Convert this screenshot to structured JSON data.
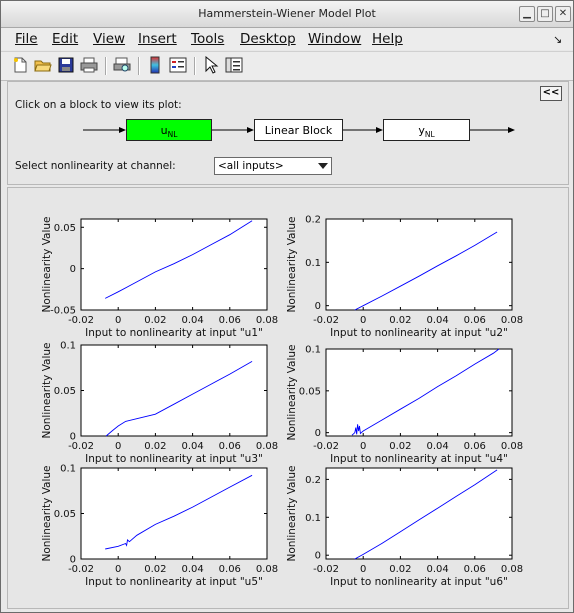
{
  "window": {
    "title": "Hammerstein-Wiener Model Plot"
  },
  "menu": [
    {
      "label": "File",
      "name": "menu-file"
    },
    {
      "label": "Edit",
      "name": "menu-edit"
    },
    {
      "label": "View",
      "name": "menu-view"
    },
    {
      "label": "Insert",
      "name": "menu-insert"
    },
    {
      "label": "Tools",
      "name": "menu-tools"
    },
    {
      "label": "Desktop",
      "name": "menu-desktop"
    },
    {
      "label": "Window",
      "name": "menu-window"
    },
    {
      "label": "Help",
      "name": "menu-help"
    }
  ],
  "toolbar": {
    "icons": [
      "new-figure-icon",
      "open-file-icon",
      "save-icon",
      "print-icon",
      "print-preview-icon",
      "colorbar-icon",
      "legend-icon",
      "pointer-icon",
      "property-editor-icon"
    ]
  },
  "panel": {
    "hint": "Click on a block to view its plot:",
    "collapse_label": "<<",
    "blocks": {
      "input_nl": {
        "main": "u",
        "sub": "NL",
        "color": "#00ff00"
      },
      "linear": {
        "label": "Linear Block"
      },
      "output_nl": {
        "main": "y",
        "sub": "NL",
        "color": "#ffffff"
      }
    },
    "select_label": "Select nonlinearity at channel:",
    "select_value": "<all inputs>"
  },
  "chart_data": [
    {
      "type": "line",
      "title": "",
      "xlabel": "Input to nonlinearity at input \"u1\"",
      "ylabel": "Nonlinearity Value",
      "xlim": [
        -0.02,
        0.08
      ],
      "ylim": [
        -0.05,
        0.06
      ],
      "xticks": [
        "-0.02",
        "0",
        "0.02",
        "0.04",
        "0.06",
        "0.08"
      ],
      "xtick_values": [
        -0.02,
        0,
        0.02,
        0.04,
        0.06,
        0.08
      ],
      "yticks": [
        "-0.05",
        "0",
        "0.05"
      ],
      "ytick_values": [
        -0.05,
        0,
        0.05
      ],
      "x": [
        -0.007,
        0.0,
        0.01,
        0.02,
        0.03,
        0.04,
        0.05,
        0.06,
        0.072
      ],
      "y": [
        -0.036,
        -0.028,
        -0.016,
        -0.004,
        0.006,
        0.017,
        0.029,
        0.041,
        0.058
      ],
      "color": "#0000ff"
    },
    {
      "type": "line",
      "title": "",
      "xlabel": "Input to nonlinearity at input \"u2\"",
      "ylabel": "Nonlinearity Value",
      "xlim": [
        -0.02,
        0.08
      ],
      "ylim": [
        -0.01,
        0.2
      ],
      "xticks": [
        "-0.02",
        "0",
        "0.02",
        "0.04",
        "0.06",
        "0.08"
      ],
      "xtick_values": [
        -0.02,
        0,
        0.02,
        0.04,
        0.06,
        0.08
      ],
      "yticks": [
        "0",
        "0.1",
        "0.2"
      ],
      "ytick_values": [
        0,
        0.1,
        0.2
      ],
      "x": [
        -0.0045,
        0.0,
        0.01,
        0.02,
        0.03,
        0.04,
        0.05,
        0.06,
        0.072
      ],
      "y": [
        -0.01,
        0.0,
        0.022,
        0.045,
        0.068,
        0.092,
        0.115,
        0.139,
        0.17
      ],
      "color": "#0000ff"
    },
    {
      "type": "line",
      "title": "",
      "xlabel": "Input to nonlinearity at input \"u3\"",
      "ylabel": "Nonlinearity Value",
      "xlim": [
        -0.02,
        0.08
      ],
      "ylim": [
        0,
        0.1
      ],
      "xticks": [
        "-0.02",
        "0",
        "0.02",
        "0.04",
        "0.06",
        "0.08"
      ],
      "xtick_values": [
        -0.02,
        0,
        0.02,
        0.04,
        0.06,
        0.08
      ],
      "yticks": [
        "0",
        "0.05",
        "0.1"
      ],
      "ytick_values": [
        0,
        0.05,
        0.1
      ],
      "x": [
        -0.0065,
        -0.003,
        0.0,
        0.004,
        0.01,
        0.02,
        0.03,
        0.04,
        0.05,
        0.06,
        0.072
      ],
      "y": [
        0.0,
        0.006,
        0.011,
        0.016,
        0.019,
        0.024,
        0.035,
        0.046,
        0.057,
        0.068,
        0.082
      ],
      "color": "#0000ff"
    },
    {
      "type": "line",
      "title": "",
      "xlabel": "Input to nonlinearity at input \"u4\"",
      "ylabel": "Nonlinearity Value",
      "xlim": [
        -0.02,
        0.08
      ],
      "ylim": [
        -0.004,
        0.1
      ],
      "xticks": [
        "-0.02",
        "0",
        "0.02",
        "0.04",
        "0.06",
        "0.08"
      ],
      "xtick_values": [
        -0.02,
        0,
        0.02,
        0.04,
        0.06,
        0.08
      ],
      "yticks": [
        "0",
        "0.05",
        "0.1"
      ],
      "ytick_values": [
        0,
        0.05,
        0.1
      ],
      "x": [
        -0.006,
        -0.0045,
        -0.004,
        -0.0035,
        -0.003,
        -0.0025,
        -0.002,
        -0.0015,
        -0.001,
        0.0,
        0.01,
        0.02,
        0.03,
        0.04,
        0.05,
        0.06,
        0.07,
        0.073
      ],
      "y": [
        -0.003,
        0.0,
        0.006,
        -0.002,
        0.01,
        0.002,
        0.008,
        -0.001,
        0.0,
        0.002,
        0.015,
        0.028,
        0.041,
        0.055,
        0.068,
        0.082,
        0.095,
        0.1
      ],
      "color": "#0000ff"
    },
    {
      "type": "line",
      "title": "",
      "xlabel": "Input to nonlinearity at input \"u5\"",
      "ylabel": "Nonlinearity Value",
      "xlim": [
        -0.02,
        0.08
      ],
      "ylim": [
        0,
        0.1
      ],
      "xticks": [
        "-0.02",
        "0",
        "0.02",
        "0.04",
        "0.06",
        "0.08"
      ],
      "xtick_values": [
        -0.02,
        0,
        0.02,
        0.04,
        0.06,
        0.08
      ],
      "yticks": [
        "0",
        "0.05",
        "0.1"
      ],
      "ytick_values": [
        0,
        0.05,
        0.1
      ],
      "x": [
        -0.007,
        0.0,
        0.004,
        0.0045,
        0.005,
        0.006,
        0.01,
        0.02,
        0.03,
        0.04,
        0.05,
        0.06,
        0.072
      ],
      "y": [
        0.011,
        0.014,
        0.017,
        0.015,
        0.021,
        0.019,
        0.026,
        0.038,
        0.047,
        0.057,
        0.068,
        0.079,
        0.092
      ],
      "color": "#0000ff"
    },
    {
      "type": "line",
      "title": "",
      "xlabel": "Input to nonlinearity at input \"u6\"",
      "ylabel": "Nonlinearity Value",
      "xlim": [
        -0.02,
        0.08
      ],
      "ylim": [
        -0.01,
        0.23
      ],
      "xticks": [
        "-0.02",
        "0",
        "0.02",
        "0.04",
        "0.06",
        "0.08"
      ],
      "xtick_values": [
        -0.02,
        0,
        0.02,
        0.04,
        0.06,
        0.08
      ],
      "yticks": [
        "0",
        "0.1",
        "0.2"
      ],
      "ytick_values": [
        0,
        0.1,
        0.2
      ],
      "x": [
        -0.0045,
        0.0,
        0.01,
        0.02,
        0.03,
        0.04,
        0.05,
        0.06,
        0.072
      ],
      "y": [
        -0.01,
        0.002,
        0.031,
        0.062,
        0.093,
        0.124,
        0.155,
        0.186,
        0.225
      ],
      "color": "#0000ff"
    }
  ]
}
